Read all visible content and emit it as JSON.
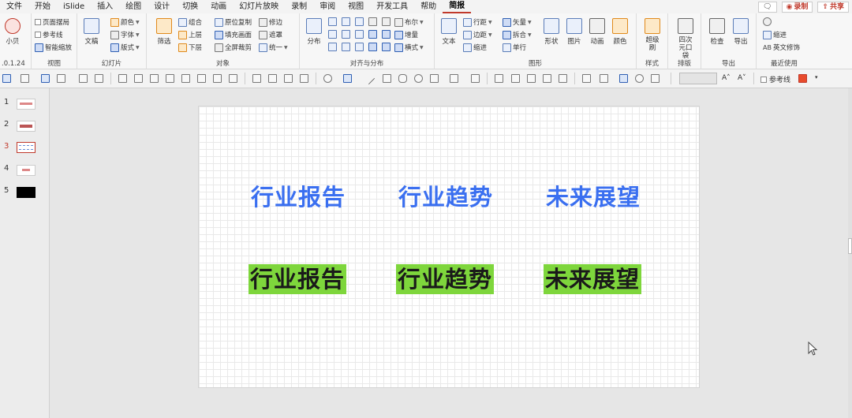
{
  "menu": {
    "items": [
      "文件",
      "开始",
      "iSlide",
      "插入",
      "绘图",
      "设计",
      "切换",
      "动画",
      "幻灯片放映",
      "录制",
      "审阅",
      "视图",
      "开发工具",
      "帮助",
      "简报"
    ],
    "active": "简报",
    "comment_icon": "comment-icon",
    "record": "录制",
    "share": "共享"
  },
  "ribbon": {
    "g0": {
      "label": ".0.1.24",
      "big": "小贝"
    },
    "view": {
      "label": "视图",
      "items": [
        "页面摆局",
        "参考线",
        "智能缩放"
      ]
    },
    "slides": {
      "label": "幻灯片",
      "big": "文稿",
      "items": [
        "颜色",
        "字体",
        "版式"
      ]
    },
    "objects": {
      "label": "对象",
      "big": "筛选",
      "col1": [
        "组合",
        "上层",
        "下层"
      ],
      "col2": [
        "原位复制",
        "填充画面",
        "全屏裁剪"
      ],
      "col3": [
        "修边",
        "遮罩",
        "统一"
      ]
    },
    "align": {
      "label": "对齐与分布",
      "big": "分布",
      "items": [
        "布尔",
        "增量",
        "横式"
      ]
    },
    "shape": {
      "label": "图形",
      "big_text": "文本",
      "col1": [
        "行距",
        "边距",
        "缩进"
      ],
      "col2": [
        "矢量",
        "拆合",
        "单行"
      ],
      "bigs": [
        "形状",
        "图片",
        "动画",
        "颜色"
      ]
    },
    "style": {
      "label": "样式",
      "big": "超级刷"
    },
    "layout": {
      "label": "排版",
      "big": "四次元口袋"
    },
    "export": {
      "label": "导出",
      "bigs": [
        "检查",
        "导出"
      ]
    },
    "recent": {
      "label": "最近使用",
      "items": [
        "缩进",
        "英文修饰"
      ],
      "ab": "AB"
    }
  },
  "quickbar": {
    "ruler_label": "参考线"
  },
  "slides": [
    {
      "num": "1",
      "active": false
    },
    {
      "num": "2",
      "active": false
    },
    {
      "num": "3",
      "active": true
    },
    {
      "num": "4",
      "active": false
    },
    {
      "num": "5",
      "active": false
    }
  ],
  "slide": {
    "row1": [
      "行业报告",
      "行业趋势",
      "未来展望"
    ],
    "row2": [
      "行业报告",
      "行业趋势",
      "未来展望"
    ],
    "blue": "#3a6ff0",
    "green": "#7ed63c"
  }
}
